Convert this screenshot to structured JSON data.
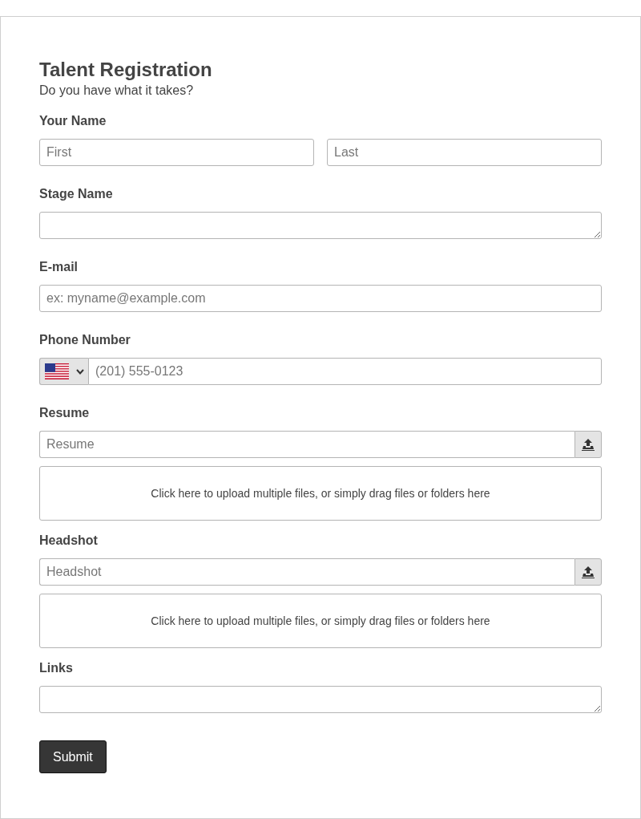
{
  "form": {
    "title": "Talent Registration",
    "subtitle": "Do you have what it takes?"
  },
  "fields": [
    {
      "kind": "name",
      "label": "Your Name",
      "inputs": [
        {
          "placeholder": "First"
        },
        {
          "placeholder": "Last"
        }
      ]
    },
    {
      "kind": "textarea",
      "label": "Stage Name"
    },
    {
      "kind": "text",
      "label": "E-mail",
      "placeholder": "ex: myname@example.com"
    },
    {
      "kind": "phone",
      "label": "Phone Number",
      "placeholder": "(201) 555-0123"
    },
    {
      "kind": "file",
      "label": "Resume",
      "placeholder": "Resume",
      "dropzone": "Click here to upload multiple files, or simply drag files or folders here"
    },
    {
      "kind": "file",
      "label": "Headshot",
      "placeholder": "Headshot",
      "dropzone": "Click here to upload multiple files, or simply drag files or folders here"
    },
    {
      "kind": "textarea",
      "label": "Links"
    }
  ],
  "submit": {
    "label": "Submit"
  }
}
